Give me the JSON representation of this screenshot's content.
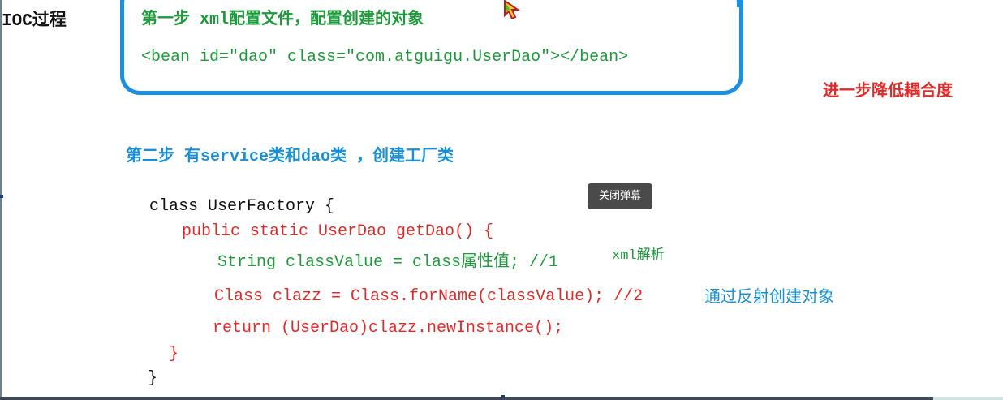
{
  "title": "IOC过程",
  "step1": {
    "heading": "第一步 xml配置文件，配置创建的对象",
    "code": "<bean id=\"dao\" class=\"com.atguigu.UserDao\"></bean>"
  },
  "side_note": "进一步降低耦合度",
  "step2": {
    "heading": "第二步 有service类和dao类 ，创建工厂类"
  },
  "code_block": {
    "class_open": "class UserFactory {",
    "method_sig": "public static UserDao getDao() {",
    "line_string": "String classValue = class属性值; //1",
    "line_string_note": "xml解析",
    "line_class": "Class clazz = Class.forName(classValue); //2",
    "line_class_note": "通过反射创建对象",
    "line_return": "return (UserDao)clazz.newInstance();",
    "method_close": "}",
    "class_close": "}"
  },
  "danmaku_button": "关闭弹幕",
  "icons": {
    "cursor": "pointer-cursor-icon"
  },
  "colors": {
    "box_border": "#1d8fe1",
    "green_text": "#1e9a3c",
    "red_text": "#e02a2a",
    "blue_text": "#1a8fd6",
    "button_bg": "#4a4a4a"
  }
}
